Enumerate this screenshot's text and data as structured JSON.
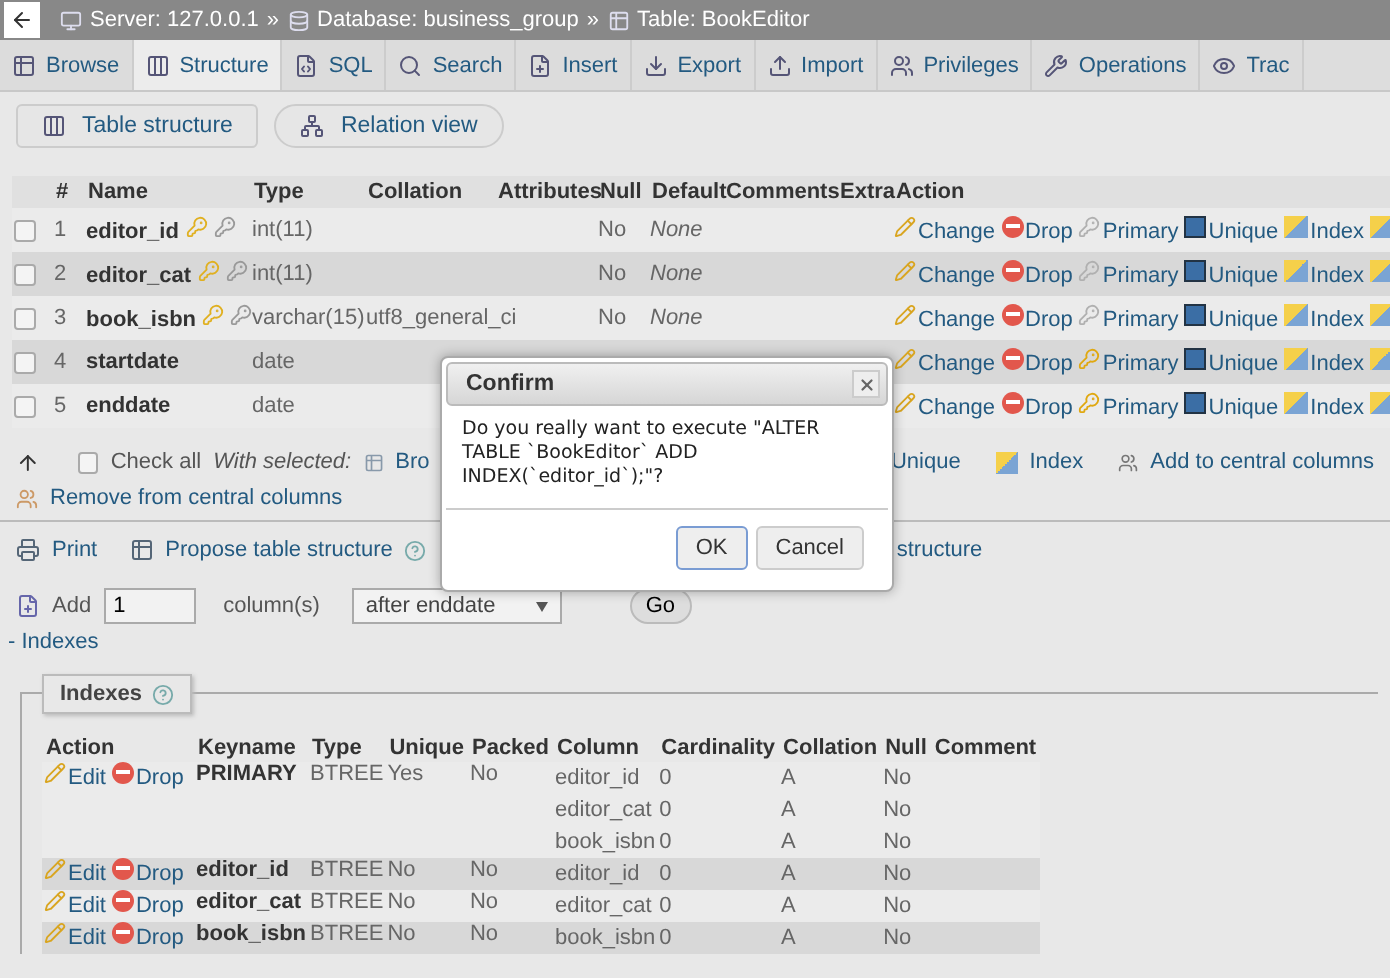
{
  "breadcrumb": [
    {
      "label": "Server: 127.0.0.1",
      "separator": "»"
    },
    {
      "label": "Database: business_group",
      "separator": "»"
    },
    {
      "label": "Table: BookEditor"
    }
  ],
  "tabs": [
    {
      "label": "Browse",
      "selected": false
    },
    {
      "label": "Structure",
      "selected": true
    },
    {
      "label": "SQL",
      "selected": false
    },
    {
      "label": "Search",
      "selected": false
    },
    {
      "label": "Insert",
      "selected": false
    },
    {
      "label": "Export",
      "selected": false
    },
    {
      "label": "Import",
      "selected": false
    },
    {
      "label": "Privileges",
      "selected": false
    },
    {
      "label": "Operations",
      "selected": false
    },
    {
      "label": "Trac",
      "selected": false
    }
  ],
  "subtabs": [
    "Table structure",
    "Relation view"
  ],
  "structure": {
    "columns": [
      "#",
      "Name",
      "Type",
      "Collation",
      "Attributes",
      "Null",
      "Default",
      "Comments",
      "Extra",
      "Action"
    ],
    "rows": [
      {
        "num": "1",
        "name": "editor_id",
        "type": "int(11)",
        "collation": "",
        "null": "No",
        "default": "None",
        "is_primary": true,
        "checked": false,
        "actions": [
          "Change",
          "Drop",
          "Primary",
          "Unique",
          "Index"
        ]
      },
      {
        "num": "2",
        "name": "editor_cat",
        "type": "int(11)",
        "collation": "",
        "null": "No",
        "default": "None",
        "is_primary": true,
        "checked": false,
        "actions": [
          "Change",
          "Drop",
          "Primary",
          "Unique",
          "Index"
        ]
      },
      {
        "num": "3",
        "name": "book_isbn",
        "type": "varchar(15)",
        "collation": "utf8_general_ci",
        "null": "No",
        "default": "None",
        "is_primary": true,
        "checked": false,
        "actions": [
          "Change",
          "Drop",
          "Primary",
          "Unique",
          "Index"
        ]
      },
      {
        "num": "4",
        "name": "startdate",
        "type": "date",
        "collation": "",
        "null": "",
        "default": "",
        "is_primary": false,
        "checked": false,
        "actions": [
          "Change",
          "Drop",
          "Primary",
          "Unique",
          "Index"
        ]
      },
      {
        "num": "5",
        "name": "enddate",
        "type": "date",
        "collation": "",
        "null": "",
        "default": "",
        "is_primary": false,
        "checked": false,
        "actions": [
          "Change",
          "Drop",
          "Primary",
          "Unique",
          "Index"
        ]
      }
    ]
  },
  "with_selected": {
    "check_all": "Check all",
    "check_all_checked": false,
    "label": "With selected:",
    "browse": "Bro",
    "unique": "Unique",
    "index": "Index",
    "add_central": "Add to central columns",
    "remove_central": "Remove from central columns"
  },
  "tools": {
    "print": "Print",
    "propose": "Propose table structure",
    "structure": "structure"
  },
  "add_columns": {
    "label": "Add",
    "value": "1",
    "unit": "column(s)",
    "position": "after enddate",
    "go": "Go"
  },
  "indexes_link": "- Indexes",
  "indexes": {
    "legend": "Indexes",
    "columns": [
      "Action",
      "Keyname",
      "Type",
      "Unique",
      "Packed",
      "Column",
      "Cardinality",
      "Collation",
      "Null",
      "Comment"
    ],
    "rows": [
      {
        "actions": [
          "Edit",
          "Drop"
        ],
        "keyname": "PRIMARY",
        "type": "BTREE",
        "unique": "Yes",
        "packed": "No",
        "parts": [
          {
            "column": "editor_id",
            "cardinality": "0",
            "collation": "A",
            "null": "No"
          },
          {
            "column": "editor_cat",
            "cardinality": "0",
            "collation": "A",
            "null": "No"
          },
          {
            "column": "book_isbn",
            "cardinality": "0",
            "collation": "A",
            "null": "No"
          }
        ]
      },
      {
        "actions": [
          "Edit",
          "Drop"
        ],
        "keyname": "editor_id",
        "type": "BTREE",
        "unique": "No",
        "packed": "No",
        "parts": [
          {
            "column": "editor_id",
            "cardinality": "0",
            "collation": "A",
            "null": "No"
          }
        ]
      },
      {
        "actions": [
          "Edit",
          "Drop"
        ],
        "keyname": "editor_cat",
        "type": "BTREE",
        "unique": "No",
        "packed": "No",
        "parts": [
          {
            "column": "editor_cat",
            "cardinality": "0",
            "collation": "A",
            "null": "No"
          }
        ]
      },
      {
        "actions": [
          "Edit",
          "Drop"
        ],
        "keyname": "book_isbn",
        "type": "BTREE",
        "unique": "No",
        "packed": "No",
        "parts": [
          {
            "column": "book_isbn",
            "cardinality": "0",
            "collation": "A",
            "null": "No"
          }
        ]
      }
    ]
  },
  "dialog": {
    "title": "Confirm",
    "message": "Do you really want to execute \"ALTER TABLE `BookEditor` ADD INDEX(`editor_id`);\"?",
    "buttons": [
      {
        "label": "OK",
        "focused": true
      },
      {
        "label": "Cancel",
        "focused": false
      }
    ]
  }
}
